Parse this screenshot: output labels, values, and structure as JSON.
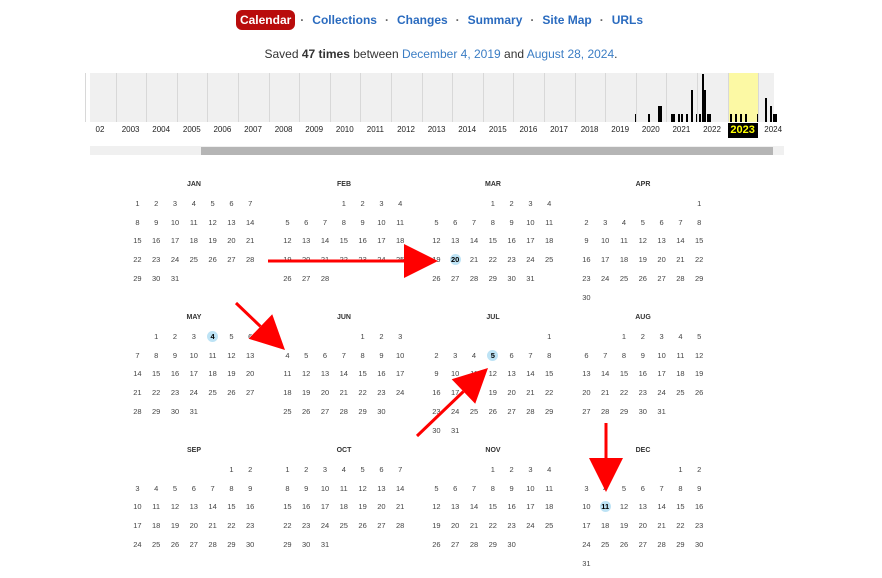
{
  "nav": {
    "items": [
      {
        "label": "Calendar",
        "active": true
      },
      {
        "label": "Collections"
      },
      {
        "label": "Changes"
      },
      {
        "label": "Summary"
      },
      {
        "label": "Site Map"
      },
      {
        "label": "URLs"
      }
    ],
    "separator": "·"
  },
  "summary": {
    "prefix": "Saved",
    "count": "47 times",
    "mid": "between",
    "first": "December 4, 2019",
    "and": "and",
    "last": "August 28, 2024",
    "end": "."
  },
  "timeline": {
    "years": [
      "02",
      "2003",
      "2004",
      "2005",
      "2006",
      "2007",
      "2008",
      "2009",
      "2010",
      "2011",
      "2012",
      "2013",
      "2014",
      "2015",
      "2016",
      "2017",
      "2018",
      "2019",
      "2020",
      "2021",
      "2022",
      "2023",
      "2024"
    ],
    "selected_year": "2023",
    "highlight_color": "#fcf9a4",
    "captures_by_year": {
      "2019": [
        0,
        0,
        0,
        0,
        0,
        0,
        0,
        0,
        0,
        0,
        0,
        1
      ],
      "2020": [
        0,
        0,
        0,
        0,
        1,
        0,
        0,
        0,
        2,
        2,
        0,
        0
      ],
      "2021": [
        0,
        1,
        1,
        0,
        1,
        1,
        0,
        1,
        0,
        4,
        0,
        1
      ],
      "2022": [
        1,
        6,
        4,
        1,
        1,
        0,
        0,
        0,
        0,
        0,
        0,
        0
      ],
      "2023": [
        1,
        0,
        1,
        0,
        1,
        0,
        1,
        0,
        0,
        0,
        0,
        1
      ],
      "2024": [
        0,
        0,
        3,
        0,
        2,
        1,
        1,
        0,
        0,
        0,
        0,
        0
      ]
    }
  },
  "calendar": {
    "year": "2023",
    "months": [
      {
        "name": "JAN",
        "start": 0,
        "days": 31,
        "saved": []
      },
      {
        "name": "FEB",
        "start": 3,
        "days": 28,
        "saved": []
      },
      {
        "name": "MAR",
        "start": 3,
        "days": 31,
        "saved": [
          20
        ]
      },
      {
        "name": "APR",
        "start": 6,
        "days": 30,
        "saved": []
      },
      {
        "name": "MAY",
        "start": 1,
        "days": 31,
        "saved": [
          4
        ]
      },
      {
        "name": "JUN",
        "start": 4,
        "days": 30,
        "saved": []
      },
      {
        "name": "JUL",
        "start": 6,
        "days": 31,
        "saved": [
          5
        ]
      },
      {
        "name": "AUG",
        "start": 2,
        "days": 31,
        "saved": []
      },
      {
        "name": "SEP",
        "start": 5,
        "days": 30,
        "saved": []
      },
      {
        "name": "OCT",
        "start": 0,
        "days": 31,
        "saved": []
      },
      {
        "name": "NOV",
        "start": 3,
        "days": 30,
        "saved": []
      },
      {
        "name": "DEC",
        "start": 5,
        "days": 31,
        "saved": [
          11
        ]
      }
    ]
  },
  "annotation_color": "#ff0000"
}
